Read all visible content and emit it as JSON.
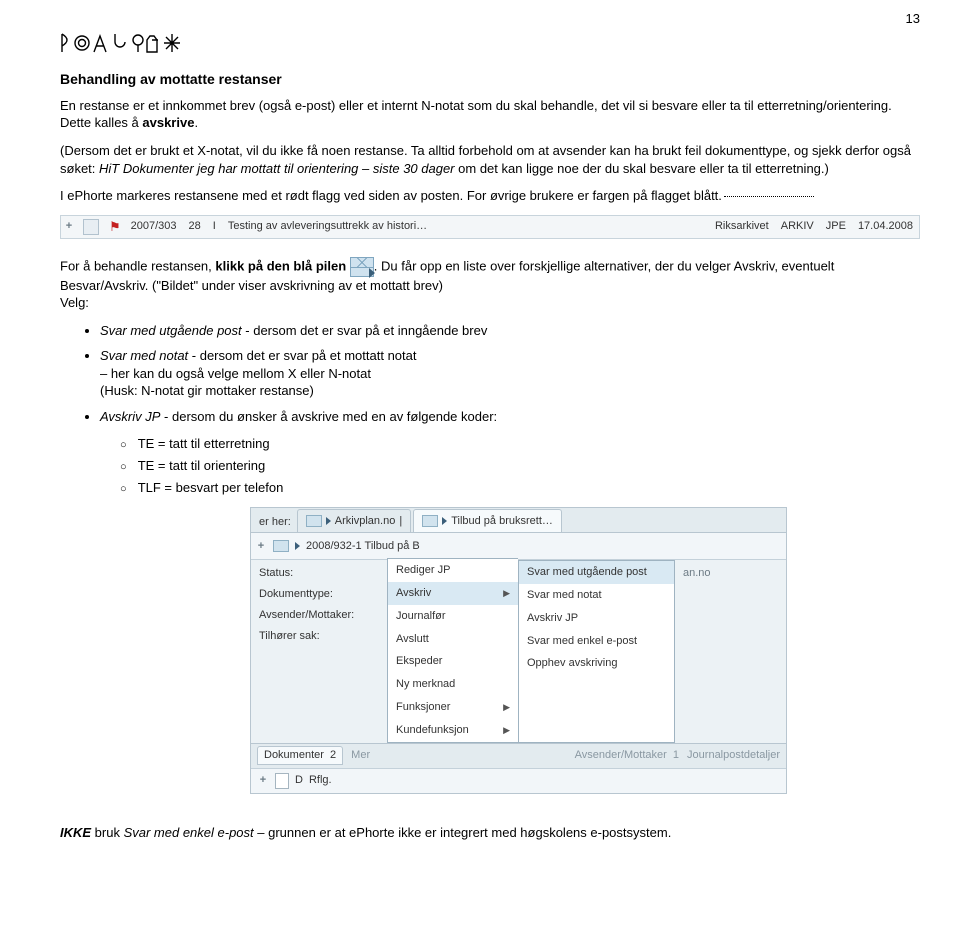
{
  "page_number": "13",
  "h2": "Behandling av mottatte restanser",
  "p1_a": "En restanse er et innkommet brev (også e-post) eller et internt N-notat som du skal behandle, det vil si besvare eller ta til etterretning/orientering. Dette kalles å ",
  "p1_bold": "avskrive",
  "p1_b": ".",
  "p2_a": "(Dersom det er brukt et X-notat, vil du ikke få noen restanse. Ta alltid forbehold om at avsender kan ha brukt feil dokumenttype, og sjekk derfor også søket: ",
  "p2_italic": "HiT Dokumenter jeg har mottatt til orientering – siste 30 dager",
  "p2_b": " om det kan ligge noe der du skal besvare eller ta til etterretning.)",
  "p3": "I ePhorte markeres restansene med et rødt flagg ved siden av posten. For øvrige brukere er fargen på flagget blått.",
  "row1": {
    "saknr": "2007/303",
    "col2": "28",
    "col3": "I",
    "title": "Testing av avleveringsuttrekk av histori…",
    "mottaker": "Riksarkivet",
    "avdeling": "ARKIV",
    "init": "JPE",
    "dato": "17.04.2008"
  },
  "p4_a": "For å behandle restansen, ",
  "p4_bold": "klikk på den blå pilen",
  "p4_b": ". Du får opp en liste over forskjellige alternativer, der du velger Avskriv, eventuelt Besvar/Avskriv. (\"Bildet\" under viser avskrivning av et mottatt brev)",
  "p4_velg": "Velg:",
  "bullets": [
    {
      "label": "Svar med utgående post",
      "text": " - dersom det er svar på et inngående brev"
    },
    {
      "label": "Svar med notat",
      "text": " - dersom det er svar på et mottatt notat",
      "sub1": "– her kan du også velge mellom X eller N-notat",
      "sub2": "(Husk: N-notat gir mottaker restanse)"
    },
    {
      "label": "Avskriv JP",
      "text": " - dersom du ønsker å avskrive med en av følgende koder:"
    }
  ],
  "codes": [
    "TE = tatt til etterretning",
    "TE = tatt til orientering",
    "TLF = besvart per telefon"
  ],
  "app": {
    "crumb_pre": "er her:",
    "tab1": "Arkivplan.no",
    "tab2": "Tilbud på bruksrett…",
    "docrow_title": "2008/932-1 Tilbud på B",
    "docrow_right": "an.no",
    "left_labels": [
      "Status:",
      "Dokumenttype:",
      "Avsender/Mottaker:",
      "Tilhører sak:"
    ],
    "menu": [
      "Rediger JP",
      "Avskriv",
      "Journalfør",
      "Avslutt",
      "Ekspeder",
      "Ny merknad",
      "Funksjoner",
      "Kundefunksjon"
    ],
    "submenu": [
      "Svar med utgående post",
      "Svar med notat",
      "Avskriv JP",
      "Svar med enkel e-post",
      "Opphev avskriving"
    ],
    "bottombar": {
      "dok": "Dokumenter",
      "dok_n": "2",
      "mer": "Mer",
      "avs": "Avsender/Mottaker",
      "avs_n": "1",
      "jp": "Journalpostdetaljer"
    },
    "tiny_d": "D",
    "tiny_rflg": "Rflg."
  },
  "final_a": "IKKE",
  "final_b": " bruk ",
  "final_italic": "Svar med enkel e-post",
  "final_c": " – grunnen er at ePhorte ikke er integrert med høgskolens e-postsystem."
}
